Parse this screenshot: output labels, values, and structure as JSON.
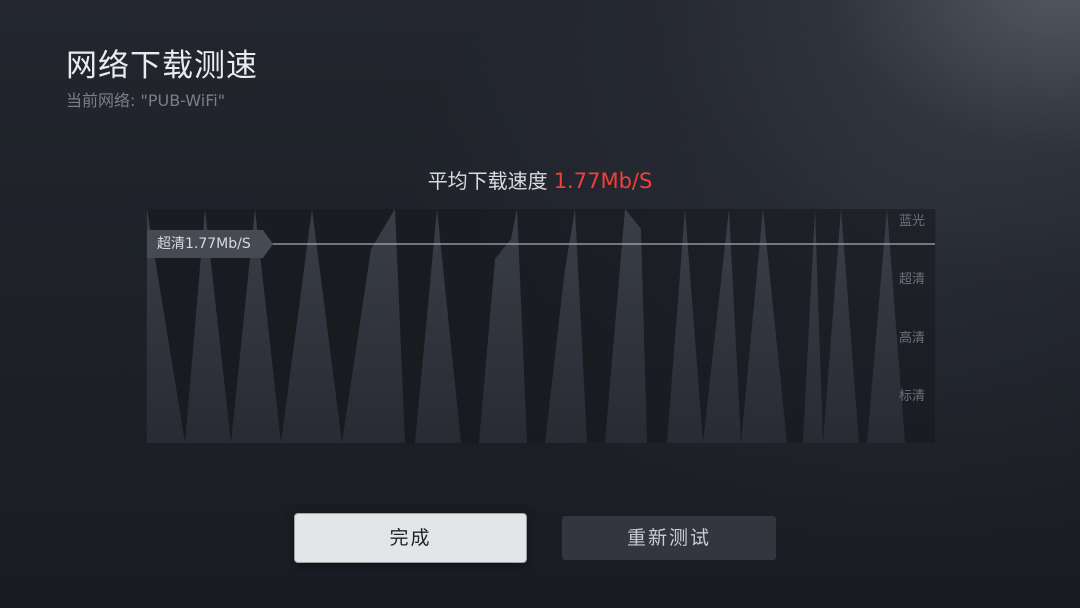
{
  "header": {
    "title": "网络下载测速",
    "network_label": "当前网络: ",
    "network_name": "\"PUB-WiFi\""
  },
  "speed": {
    "label": "平均下载速度",
    "value": "1.77Mb/S"
  },
  "chart": {
    "threshold_tag": "超清1.77Mb/S",
    "quality_levels": [
      "蓝光",
      "超清",
      "高清",
      "标清"
    ]
  },
  "actions": {
    "done_label": "完成",
    "retest_label": "重新测试"
  },
  "colors": {
    "accent_speed": "#f0403c",
    "button_focused_bg": "#e4e5e8",
    "button_bg": "#33363e"
  }
}
